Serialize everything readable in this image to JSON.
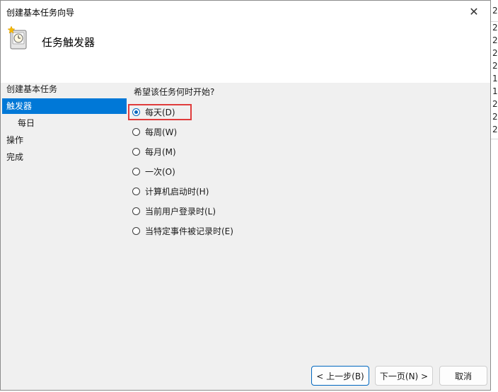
{
  "window": {
    "title": "创建基本任务向导",
    "close_glyph": "✕",
    "header_title": "任务触发器"
  },
  "sidebar": {
    "items": [
      {
        "label": "创建基本任务"
      },
      {
        "label": "触发器",
        "selected": true
      },
      {
        "label": "每日"
      },
      {
        "label": "操作"
      },
      {
        "label": "完成"
      }
    ]
  },
  "main": {
    "question": "希望该任务何时开始?",
    "options": [
      {
        "label": "每天(D)",
        "checked": true
      },
      {
        "label": "每周(W)"
      },
      {
        "label": "每月(M)"
      },
      {
        "label": "一次(O)"
      },
      {
        "label": "计算机启动时(H)"
      },
      {
        "label": "当前用户登录时(L)"
      },
      {
        "label": "当特定事件被记录时(E)"
      }
    ]
  },
  "buttons": {
    "back": "< 上一步(B)",
    "next": "下一页(N) >",
    "cancel": "取消"
  },
  "background_window": {
    "glyphs": [
      "2",
      "2",
      "2",
      "2",
      "2",
      "1",
      "1",
      "2",
      "2",
      "2"
    ]
  },
  "colors": {
    "selection": "#0078d7",
    "highlight_box": "#e03c3c",
    "radio_checked": "#0067c0"
  },
  "icons": {
    "header": "task-scheduler-clock-icon",
    "close": "close-icon"
  }
}
